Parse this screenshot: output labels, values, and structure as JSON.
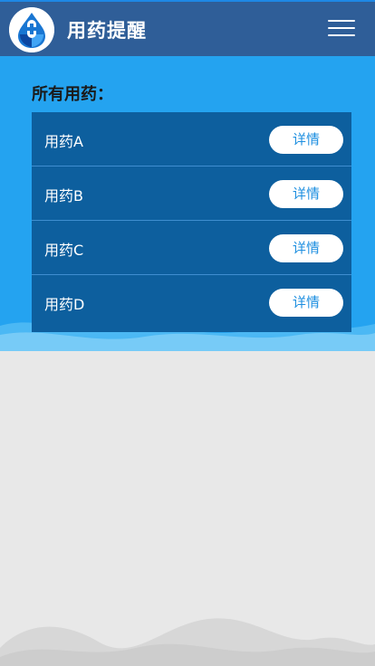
{
  "header": {
    "title": "用药提醒",
    "logo_icon": "pill-drop-logo-icon",
    "menu_icon": "hamburger-menu-icon"
  },
  "main": {
    "section_title": "所有用药：",
    "medications": [
      {
        "name": "用药A",
        "button_label": "详情"
      },
      {
        "name": "用药B",
        "button_label": "详情"
      },
      {
        "name": "用药C",
        "button_label": "详情"
      },
      {
        "name": "用药D",
        "button_label": "详情"
      }
    ]
  },
  "colors": {
    "header_bg": "#2f5e98",
    "banner_bg": "#24a3f0",
    "list_bg": "#0d5f9e",
    "button_text": "#1e8fe0",
    "page_bg": "#e8e8e8"
  }
}
